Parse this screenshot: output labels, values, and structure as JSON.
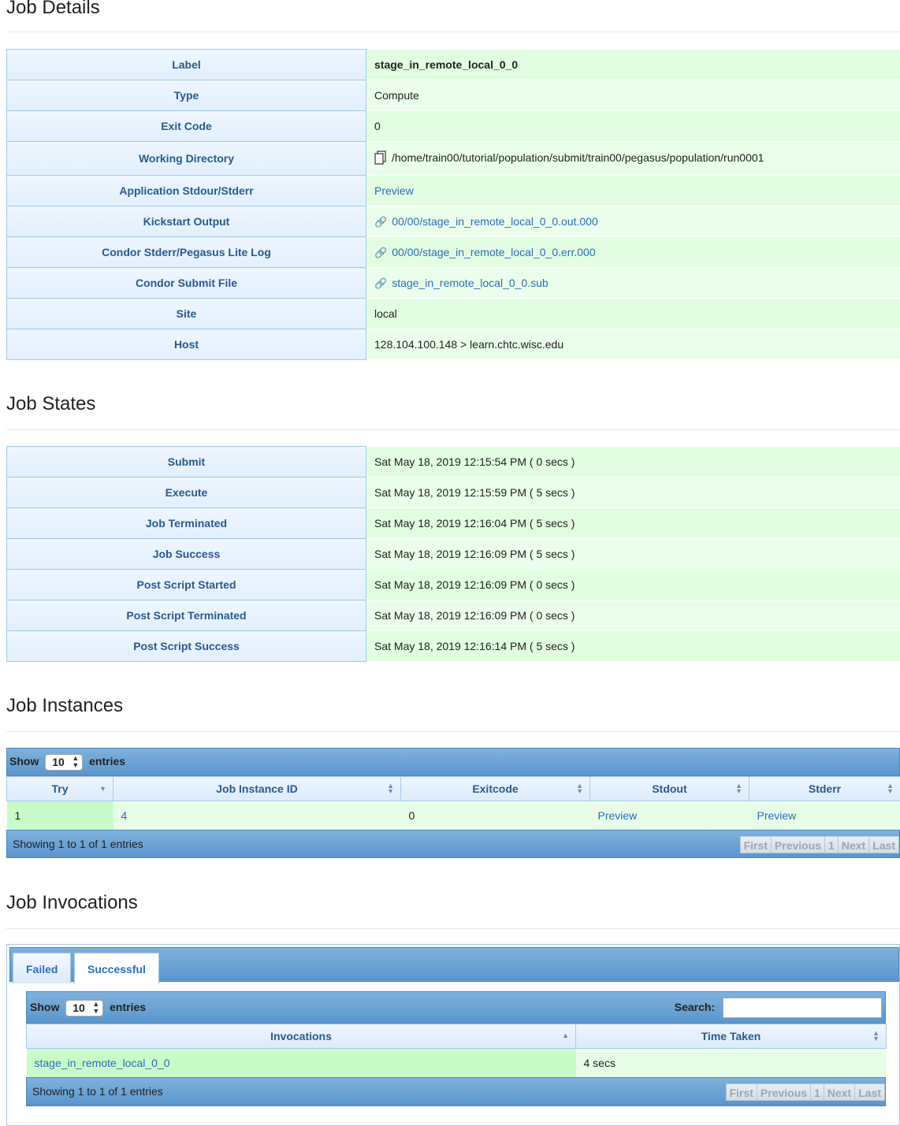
{
  "job_details": {
    "title": "Job Details",
    "rows": [
      {
        "key": "Label",
        "value": "stage_in_remote_local_0_0"
      },
      {
        "key": "Type",
        "value": "Compute"
      },
      {
        "key": "Exit Code",
        "value": "0"
      },
      {
        "key": "Working Directory",
        "value": "/home/train00/tutorial/population/submit/train00/pegasus/population/run0001"
      },
      {
        "key": "Application Stdour/Stderr",
        "value": "Preview"
      },
      {
        "key": "Kickstart Output",
        "value": "00/00/stage_in_remote_local_0_0.out.000"
      },
      {
        "key": "Condor Stderr/Pegasus Lite Log",
        "value": "00/00/stage_in_remote_local_0_0.err.000"
      },
      {
        "key": "Condor Submit File",
        "value": "stage_in_remote_local_0_0.sub"
      },
      {
        "key": "Site",
        "value": "local"
      },
      {
        "key": "Host",
        "value": "128.104.100.148 > learn.chtc.wisc.edu"
      }
    ]
  },
  "job_states": {
    "title": "Job States",
    "rows": [
      {
        "key": "Submit",
        "value": "Sat May 18, 2019 12:15:54 PM ( 0 secs )"
      },
      {
        "key": "Execute",
        "value": "Sat May 18, 2019 12:15:59 PM ( 5 secs )"
      },
      {
        "key": "Job Terminated",
        "value": "Sat May 18, 2019 12:16:04 PM ( 5 secs )"
      },
      {
        "key": "Job Success",
        "value": "Sat May 18, 2019 12:16:09 PM ( 5 secs )"
      },
      {
        "key": "Post Script Started",
        "value": "Sat May 18, 2019 12:16:09 PM ( 0 secs )"
      },
      {
        "key": "Post Script Terminated",
        "value": "Sat May 18, 2019 12:16:09 PM ( 0 secs )"
      },
      {
        "key": "Post Script Success",
        "value": "Sat May 18, 2019 12:16:14 PM ( 5 secs )"
      }
    ]
  },
  "job_instances": {
    "title": "Job Instances",
    "show_label": "Show",
    "page_size": "10",
    "entries_label": "entries",
    "columns": [
      "Try",
      "Job Instance ID",
      "Exitcode",
      "Stdout",
      "Stderr"
    ],
    "rows": [
      {
        "try": "1",
        "instance_id": "4",
        "exitcode": "0",
        "stdout": "Preview",
        "stderr": "Preview"
      }
    ],
    "info": "Showing 1 to 1 of 1 entries",
    "pager": {
      "first": "First",
      "previous": "Previous",
      "page": "1",
      "next": "Next",
      "last": "Last"
    }
  },
  "job_invocations": {
    "title": "Job Invocations",
    "tabs": [
      "Failed",
      "Successful"
    ],
    "active_tab": "Successful",
    "show_label": "Show",
    "page_size": "10",
    "entries_label": "entries",
    "search_label": "Search:",
    "search_value": "",
    "columns": [
      "Invocations",
      "Time Taken"
    ],
    "rows": [
      {
        "invocation": "stage_in_remote_local_0_0",
        "time_taken": "4 secs"
      }
    ],
    "info": "Showing 1 to 1 of 1 entries",
    "pager": {
      "first": "First",
      "previous": "Previous",
      "page": "1",
      "next": "Next",
      "last": "Last"
    }
  },
  "colors": {
    "accent": "#2a6ebb",
    "header_bar": "#6aa3d5",
    "row_green": "#e2fde2"
  }
}
